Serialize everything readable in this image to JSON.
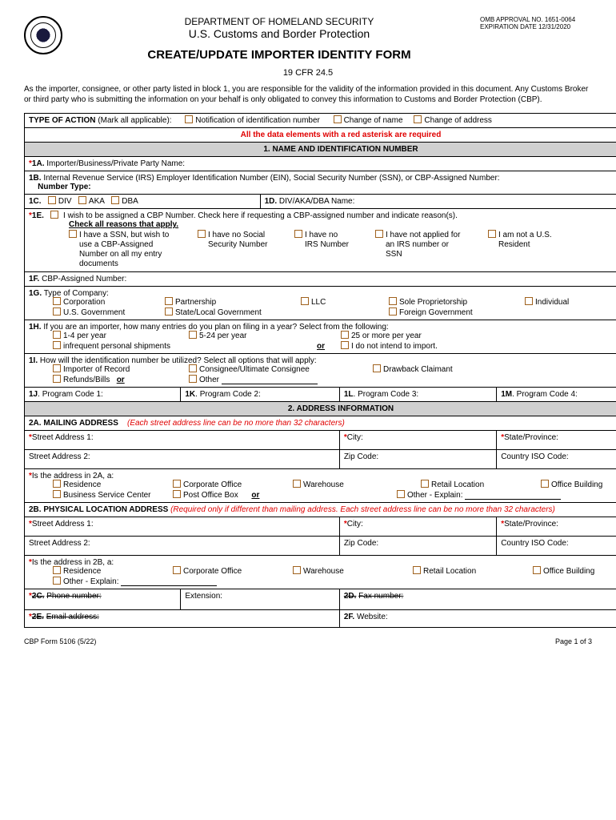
{
  "header": {
    "dept": "DEPARTMENT OF HOMELAND SECURITY",
    "agency": "U.S. Customs and Border Protection",
    "title": "CREATE/UPDATE IMPORTER IDENTITY FORM",
    "cfr": "19 CFR 24.5",
    "omb": "OMB APPROVAL NO. 1651-0064",
    "exp": "EXPIRATION DATE 12/31/2020"
  },
  "intro": "As the importer, consignee, or other party listed in block 1, you are responsible for the validity of the information provided in this document. Any Customs Broker or third party who is submitting the information on your behalf is only obligated to convey this information to Customs and Border Protection (CBP).",
  "typeOfAction": {
    "label": "TYPE OF ACTION",
    "hint": "(Mark all applicable):",
    "opts": [
      "Notification of identification number",
      "Change of name",
      "Change of address"
    ]
  },
  "redNotice": "All the data elements with a red asterisk are required",
  "section1": {
    "title": "1. NAME AND IDENTIFICATION NUMBER",
    "f1A": "1A.",
    "f1A_label": "Importer/Business/Private Party Name:",
    "f1B": "1B.",
    "f1B_label": "Internal Revenue Service (IRS) Employer Identification Number (EIN), Social Security Number (SSN), or CBP-Assigned Number:",
    "f1B_sub": "Number Type:",
    "f1C": "1C.",
    "f1C_opts": [
      "DIV",
      "AKA",
      "DBA"
    ],
    "f1D": "1D.",
    "f1D_label": "DIV/AKA/DBA Name:",
    "f1E": "1E.",
    "f1E_label": "I wish to be assigned a CBP Number. Check here if requesting a CBP-assigned number and indicate reason(s).",
    "f1E_check": "Check all reasons that apply.",
    "f1E_opts": [
      "I have a SSN, but wish to use a CBP-Assigned Number on all my entry documents",
      "I have no Social Security Number",
      "I have no IRS Number",
      "I have not applied for an IRS number or SSN",
      "I am not a U.S. Resident"
    ],
    "f1F": "1F.",
    "f1F_label": "CBP-Assigned Number:",
    "f1G": "1G.",
    "f1G_label": "Type of Company:",
    "f1G_opts": [
      "Corporation",
      "Partnership",
      "LLC",
      "Sole Proprietorship",
      "Individual",
      "U.S. Government",
      "State/Local Government",
      "Foreign Government"
    ],
    "f1H": "1H.",
    "f1H_label": "If you are an importer, how many entries do you plan on filing in a year? Select from the following:",
    "f1H_opts": [
      "1-4 per year",
      "5-24 per year",
      "25 or more per year",
      "infrequent personal shipments",
      "I do not intend to import."
    ],
    "f1I": "1I.",
    "f1I_label": "How will the identification number be utilized? Select all options that will apply:",
    "f1I_opts": [
      "Importer of Record",
      "Consignee/Ultimate Consignee",
      "Drawback Claimant",
      "Refunds/Bills",
      "Other"
    ],
    "f1J": "1J",
    "f1J_label": "Program Code 1:",
    "f1K": "1K",
    "f1K_label": "Program Code 2:",
    "f1L": "1L",
    "f1L_label": "Program Code 3:",
    "f1M": "1M",
    "f1M_label": "Program Code 4:"
  },
  "section2": {
    "title": "2. ADDRESS INFORMATION",
    "f2A": "2A. MAILING ADDRESS",
    "f2A_hint": "(Each street address line can be no more than 32 characters)",
    "street1": "Street Address 1:",
    "street2": "Street Address 2:",
    "city": "City:",
    "zip": "Zip Code:",
    "state": "State/Province:",
    "iso": "Country ISO Code:",
    "addr2A_q": "Is the address in 2A, a:",
    "addr_opts": [
      "Residence",
      "Corporate Office",
      "Warehouse",
      "Retail Location",
      "Office Building",
      "Business Service Center",
      "Post Office Box",
      "Other - Explain:"
    ],
    "f2B": "2B. PHYSICAL LOCATION ADDRESS",
    "f2B_hint": "(Required only if different than mailing address.  Each street address line can be no more than 32 characters)",
    "addr2B_q": "Is the address in 2B, a:",
    "addr2B_opts": [
      "Residence",
      "Corporate Office",
      "Warehouse",
      "Retail Location",
      "Office Building",
      "Other - Explain:"
    ],
    "f2C": "2C.",
    "f2C_label": "Phone number:",
    "f2C_ext": "Extension:",
    "f2D": "2D.",
    "f2D_label": "Fax number:",
    "f2E": "2E.",
    "f2E_label": "Email address:",
    "f2F": "2F.",
    "f2F_label": "Website:"
  },
  "or": "or",
  "footer": {
    "left": "CBP Form 5106 (5/22)",
    "right": "Page 1 of 3"
  }
}
